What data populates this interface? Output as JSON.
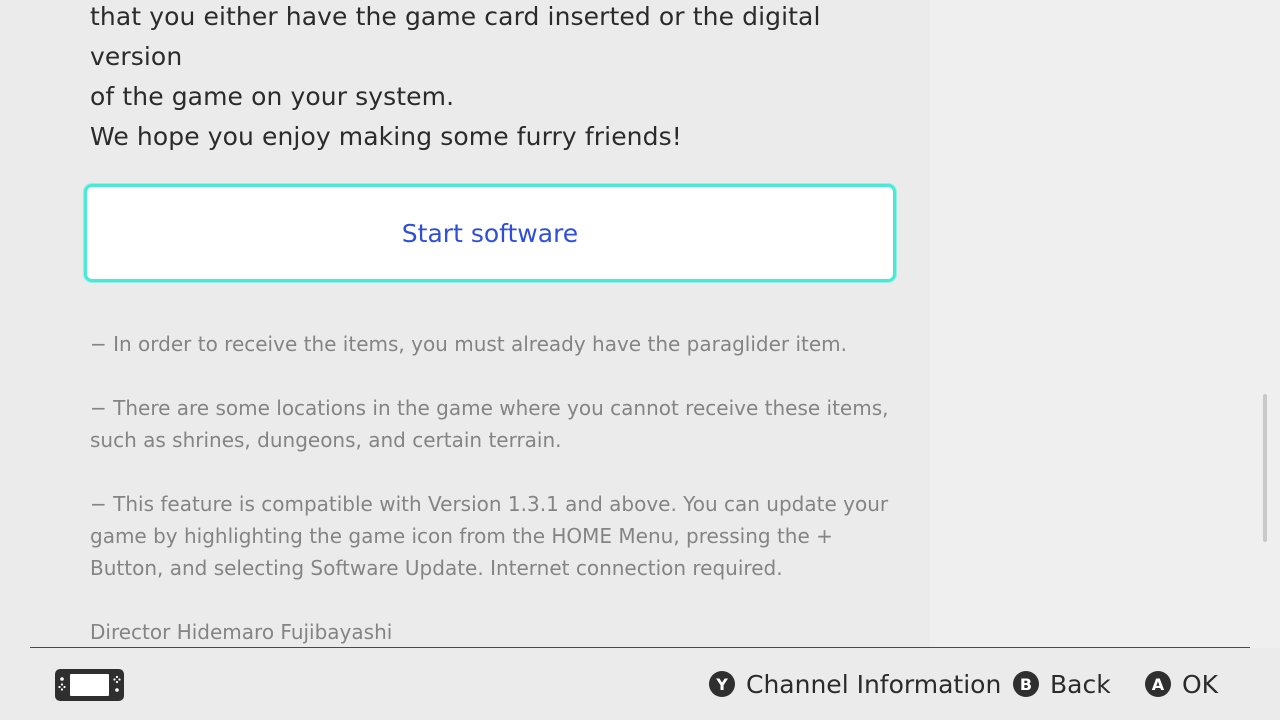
{
  "content": {
    "paragraph_top_line1": "that you either have the game card inserted or the digital version",
    "paragraph_top_line2": "of the game on your system.",
    "paragraph_hope": "We hope you enjoy making some furry friends!",
    "start_button_label": "Start software",
    "notes": [
      "− In order to receive the items, you must already have the paraglider item.",
      "− There are some locations in the game where you cannot receive these items, such as shrines, dungeons, and certain terrain.",
      "− This feature is compatible with Version 1.3.1 and above. You can update your game by highlighting the game icon from the HOME Menu, pressing the + Button, and selecting Software Update. Internet connection required."
    ],
    "director": "Director Hidemaro Fujibayashi"
  },
  "footer": {
    "console_icon": "handheld-console-icon",
    "hints": [
      {
        "button": "Y",
        "label": "Channel Information"
      },
      {
        "button": "B",
        "label": "Back"
      },
      {
        "button": "A",
        "label": "OK"
      }
    ]
  },
  "colors": {
    "background": "#ebebeb",
    "highlight_border": "#4be8d6",
    "button_text": "#2f4fd8",
    "body_text": "#2b2b2b",
    "note_text": "#848484"
  }
}
